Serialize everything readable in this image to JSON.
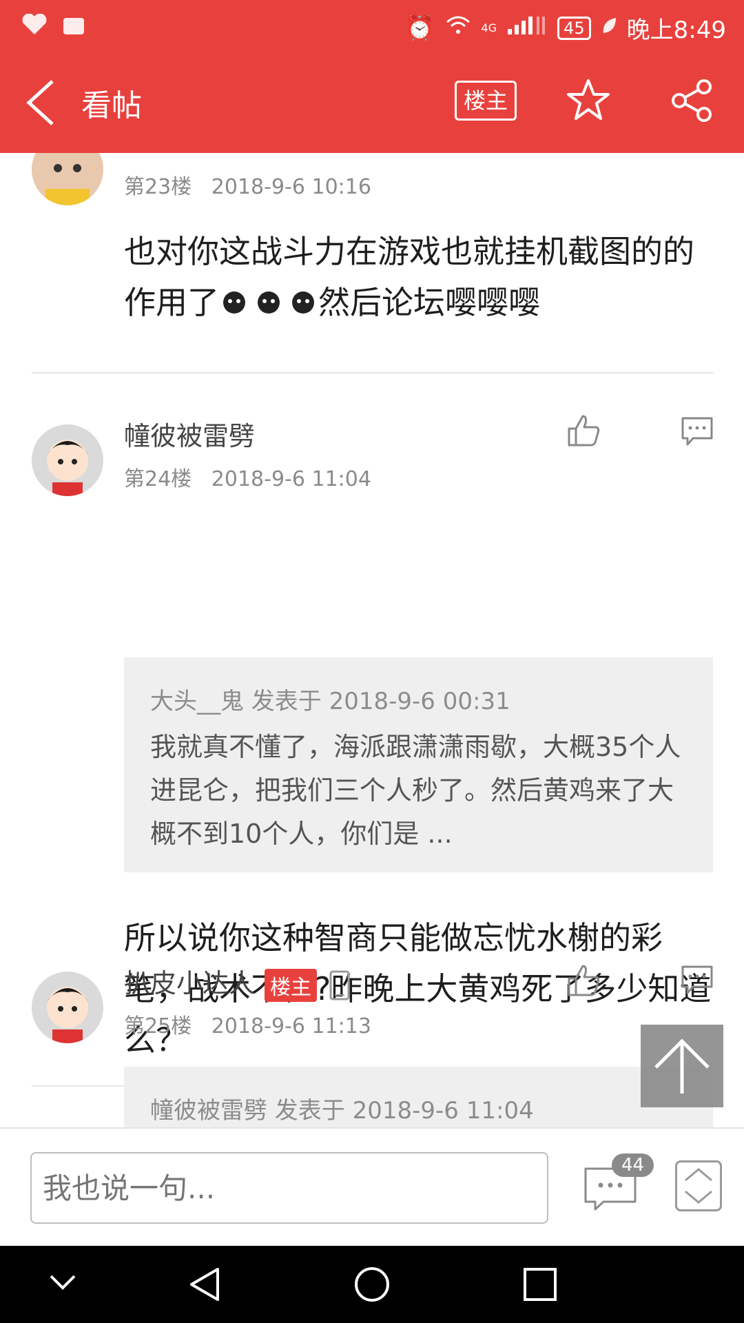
{
  "status_bar": {
    "time": "晚上8:49",
    "battery": "45",
    "network": "4G"
  },
  "header": {
    "title": "看帖",
    "op_only_label": "楼主"
  },
  "posts": [
    {
      "floor": "第23楼",
      "date": "2018-9-6 10:16",
      "body": "也对你这战斗力在游戏也就挂机截图的的作用了",
      "body_tail": "然后论坛嘤嘤嘤"
    },
    {
      "author": "幢彼被雷劈",
      "floor": "第24楼",
      "date": "2018-9-6 11:04",
      "quote": {
        "meta": "大头__鬼 发表于 2018-9-6 00:31",
        "text": "我就真不懂了，海派跟潇潇雨歇，大概35个人进昆仑，把我们三个人秒了。然后黄鸡来了大概不到10个人，你们是 ..."
      },
      "body": "所以说你这种智商只能做忘忧水榭的彩笔，战术不懂?昨晚上大黄鸡死了多少知道么？"
    },
    {
      "author": "扒皮小达人",
      "badge": "楼主",
      "floor": "第25楼",
      "date": "2018-9-6 11:13",
      "quote": {
        "meta": "幢彼被雷劈 发表于 2018-9-6 11:04"
      }
    }
  ],
  "bottom_bar": {
    "input_placeholder": "我也说一句...",
    "comment_count": "44"
  },
  "colors": {
    "brand": "#e8413d",
    "quote_bg": "#efefef"
  }
}
